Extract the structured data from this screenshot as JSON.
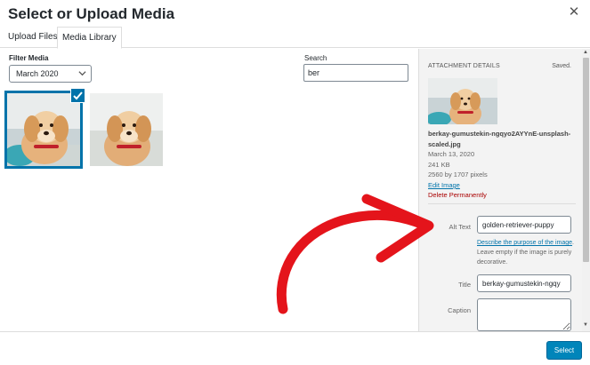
{
  "modal": {
    "title": "Select or Upload Media"
  },
  "tabs": [
    {
      "label": "Upload Files"
    },
    {
      "label": "Media Library"
    }
  ],
  "filter": {
    "label": "Filter Media",
    "selected": "March 2020"
  },
  "search": {
    "label": "Search",
    "value": "ber"
  },
  "attachment": {
    "header": "ATTACHMENT DETAILS",
    "status": "Saved.",
    "filename": "berkay-gumustekin-ngqyo2AYYnE-unsplash-scaled.jpg",
    "date": "March 13, 2020",
    "size": "241 KB",
    "dimensions": "2560 by 1707 pixels",
    "edit_label": "Edit Image",
    "delete_label": "Delete Permanently"
  },
  "fields": {
    "alt_label": "Alt Text",
    "alt_value": "golden-retriever-puppy",
    "alt_link": "Describe the purpose of the image",
    "alt_help": ". Leave empty if the image is purely decorative.",
    "title_label": "Title",
    "title_value": "berkay-gumustekin-ngqy",
    "caption_label": "Caption",
    "caption_value": ""
  },
  "footer": {
    "select_label": "Select"
  },
  "colors": {
    "accent": "#0073aa",
    "danger": "#a00000",
    "arrow": "#e4141b",
    "primary_button": "#0085ba"
  }
}
